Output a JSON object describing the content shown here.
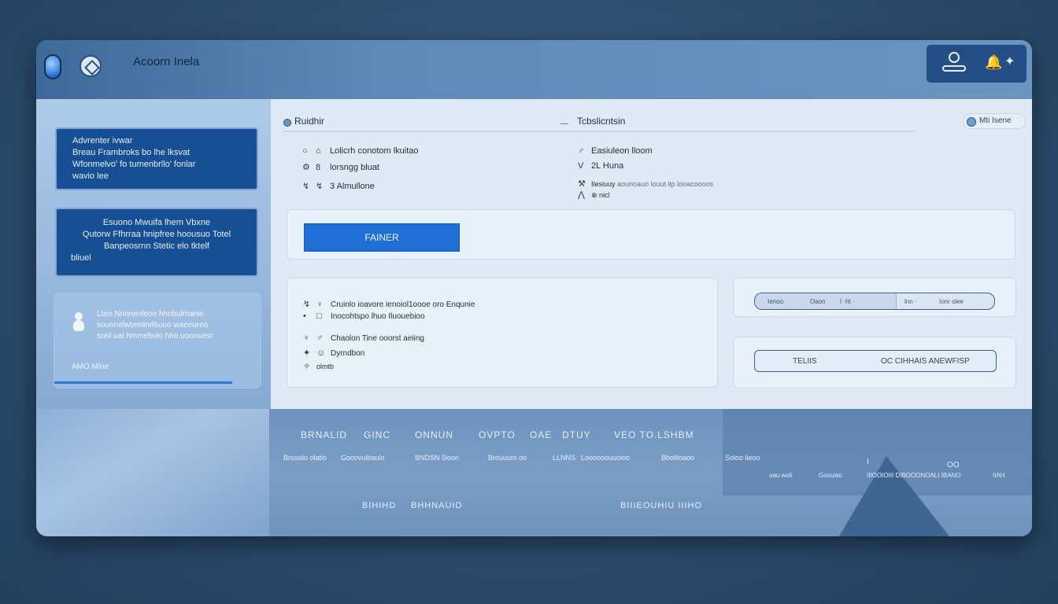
{
  "window": {
    "title": "Acoorn Inela"
  },
  "header": {
    "tools": [
      "user-icon",
      "bell-icon",
      "sparkle-icon"
    ],
    "bell_glyph": "🔔",
    "sparkle_glyph": "✦"
  },
  "sidebar": {
    "card1": [
      "Advrenter ivwar",
      "Breau Frambroks bo lhe lksvat",
      "Wfonmelvo' fo tumenbrllo' fonlar",
      "wavio lee"
    ],
    "card2": [
      "Esuono Mwuifa lhem Vbxne",
      "Qutorw Ffhrraa hnipfree hoousuo Totel",
      "Banpeosrnn Stetic elo tktelf",
      "bliuel"
    ],
    "card3": {
      "info": [
        "Lteo Nnnnenleoe hhnbulmanio",
        "sounnelwtemlnrl6uoo waeeoreo",
        "sonl ual hmmebolo hho uoonuesr"
      ],
      "footer": "AMO Mine"
    }
  },
  "main": {
    "tabs": {
      "left": "Ruidhir",
      "mid_prefix": "—",
      "mid": "Tcbslicntsin"
    },
    "pill": "Mti Isene",
    "details_left": [
      {
        "s1": "○",
        "s2": "⌂",
        "text": "Lolicrh conotom lkuitao"
      },
      {
        "s1": "⚙",
        "s2": "8",
        "text": "lorsngg bluat"
      },
      {
        "s1": "↯",
        "s2": "↯",
        "text": "3 Almullone"
      }
    ],
    "details_right": [
      {
        "s1": "♂",
        "text": "Easiuleon lloom"
      },
      {
        "s1": "V",
        "text": "2L Huna"
      },
      {
        "s1": "⚒",
        "text": "Ilesiuuy",
        "extra": "aounoauo louut lip looacoooos"
      },
      {
        "s1": "⋀",
        "text": "⊗ nicl"
      }
    ],
    "primary_button": "FAINER",
    "list_items": [
      {
        "s1": "↯",
        "s2": "♀",
        "text": "Cruinlo ioavore ienoiol1oooe oro Enqunie"
      },
      {
        "s1": "•",
        "s2": "□",
        "text": "Inocohtspo lhuo Iluouebioo"
      },
      {
        "s1": "♀",
        "s2": "♂",
        "text": "Chaolon Tine ooorst aeiing"
      },
      {
        "s1": "✦",
        "s2": "☺",
        "text": "Dyrndbon"
      },
      {
        "s1": "✧",
        "s2": "",
        "text": "olmtb"
      }
    ],
    "segment": {
      "a": "Ienoo",
      "b": "Oaon",
      "c": "I ·ht ·",
      "d": "lnn ·",
      "e": "Ionr olee"
    },
    "outline_button": {
      "left": "TELIIS",
      "right": "OC CIHHAIS ANEWFISP"
    }
  },
  "footer": {
    "row1": [
      "BRNALID",
      "GINC",
      "ONNUN",
      "OVPTO",
      "OAE",
      "DTUY",
      "VEO TO.LSHBM"
    ],
    "row2": [
      "Bnuudo olatio",
      "Gooovulbaulo",
      "BNDSN 5loon",
      "Brouuum oo",
      "LLNNS",
      "Loooooouuoioo",
      "Bbollioaoo",
      "Soloo lieoo"
    ],
    "row3": [
      "oau woli",
      "Goouwo",
      "IIIOOIOIII DIBOOONOALI IBANO",
      "IIAH"
    ],
    "marks": [
      "OO",
      "I"
    ],
    "row4": [
      "BIHIHD",
      "BHHNAUID",
      "BIIIEOUHIU IIIHO"
    ]
  }
}
